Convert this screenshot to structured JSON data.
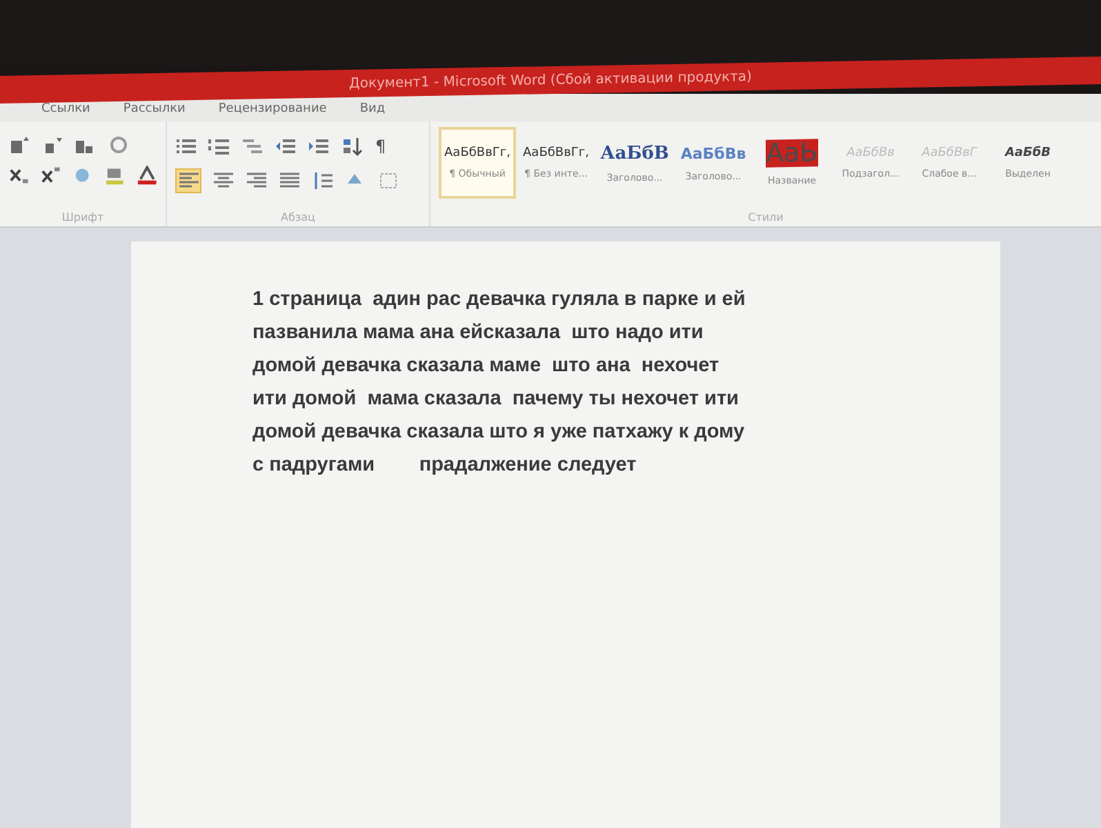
{
  "window": {
    "title": "Документ1 - Microsoft Word (Сбой активации продукта)"
  },
  "tabs": [
    {
      "label": "Ссылки",
      "selected": false
    },
    {
      "label": "Рассылки",
      "selected": false
    },
    {
      "label": "Рецензирование",
      "selected": false
    },
    {
      "label": "Вид",
      "selected": false
    }
  ],
  "groups": {
    "font": "Шрифт",
    "paragraph": "Абзац",
    "styles": "Стили"
  },
  "paragraph_tools": {
    "align_left_selected": true,
    "show_marks_label": "¶"
  },
  "styles": [
    {
      "preview": "АаБбВвГг,",
      "name": "¶ Обычный",
      "kind": "normal",
      "selected": true
    },
    {
      "preview": "АаБбВвГг,",
      "name": "¶ Без инте...",
      "kind": "normal",
      "selected": false
    },
    {
      "preview": "АаБбВ",
      "name": "Заголово...",
      "kind": "heading1",
      "selected": false
    },
    {
      "preview": "АаБбВв",
      "name": "Заголово...",
      "kind": "heading2",
      "selected": false
    },
    {
      "preview": "АаЬ",
      "name": "Название",
      "kind": "title",
      "selected": false
    },
    {
      "preview": "АаБбВв",
      "name": "Подзагол...",
      "kind": "subtle",
      "selected": false
    },
    {
      "preview": "АаБбВвГ",
      "name": "Слабое в...",
      "kind": "subtle",
      "selected": false
    },
    {
      "preview": "АаБбВ",
      "name": "Выделен",
      "kind": "emphasis",
      "selected": false
    }
  ],
  "document": {
    "lines": [
      "1 страница  адин рас девачка гуляла в парке и ей",
      "пазванила мама ана ейсказала  што надо ити",
      "домой девачка сказала маме  што ана  нехочет",
      "ити домой  мама сказала  пачему ты нехочет ити",
      "домой девачка сказала што я уже патхажу к дому",
      "с падругами        прадалжение следует"
    ]
  }
}
